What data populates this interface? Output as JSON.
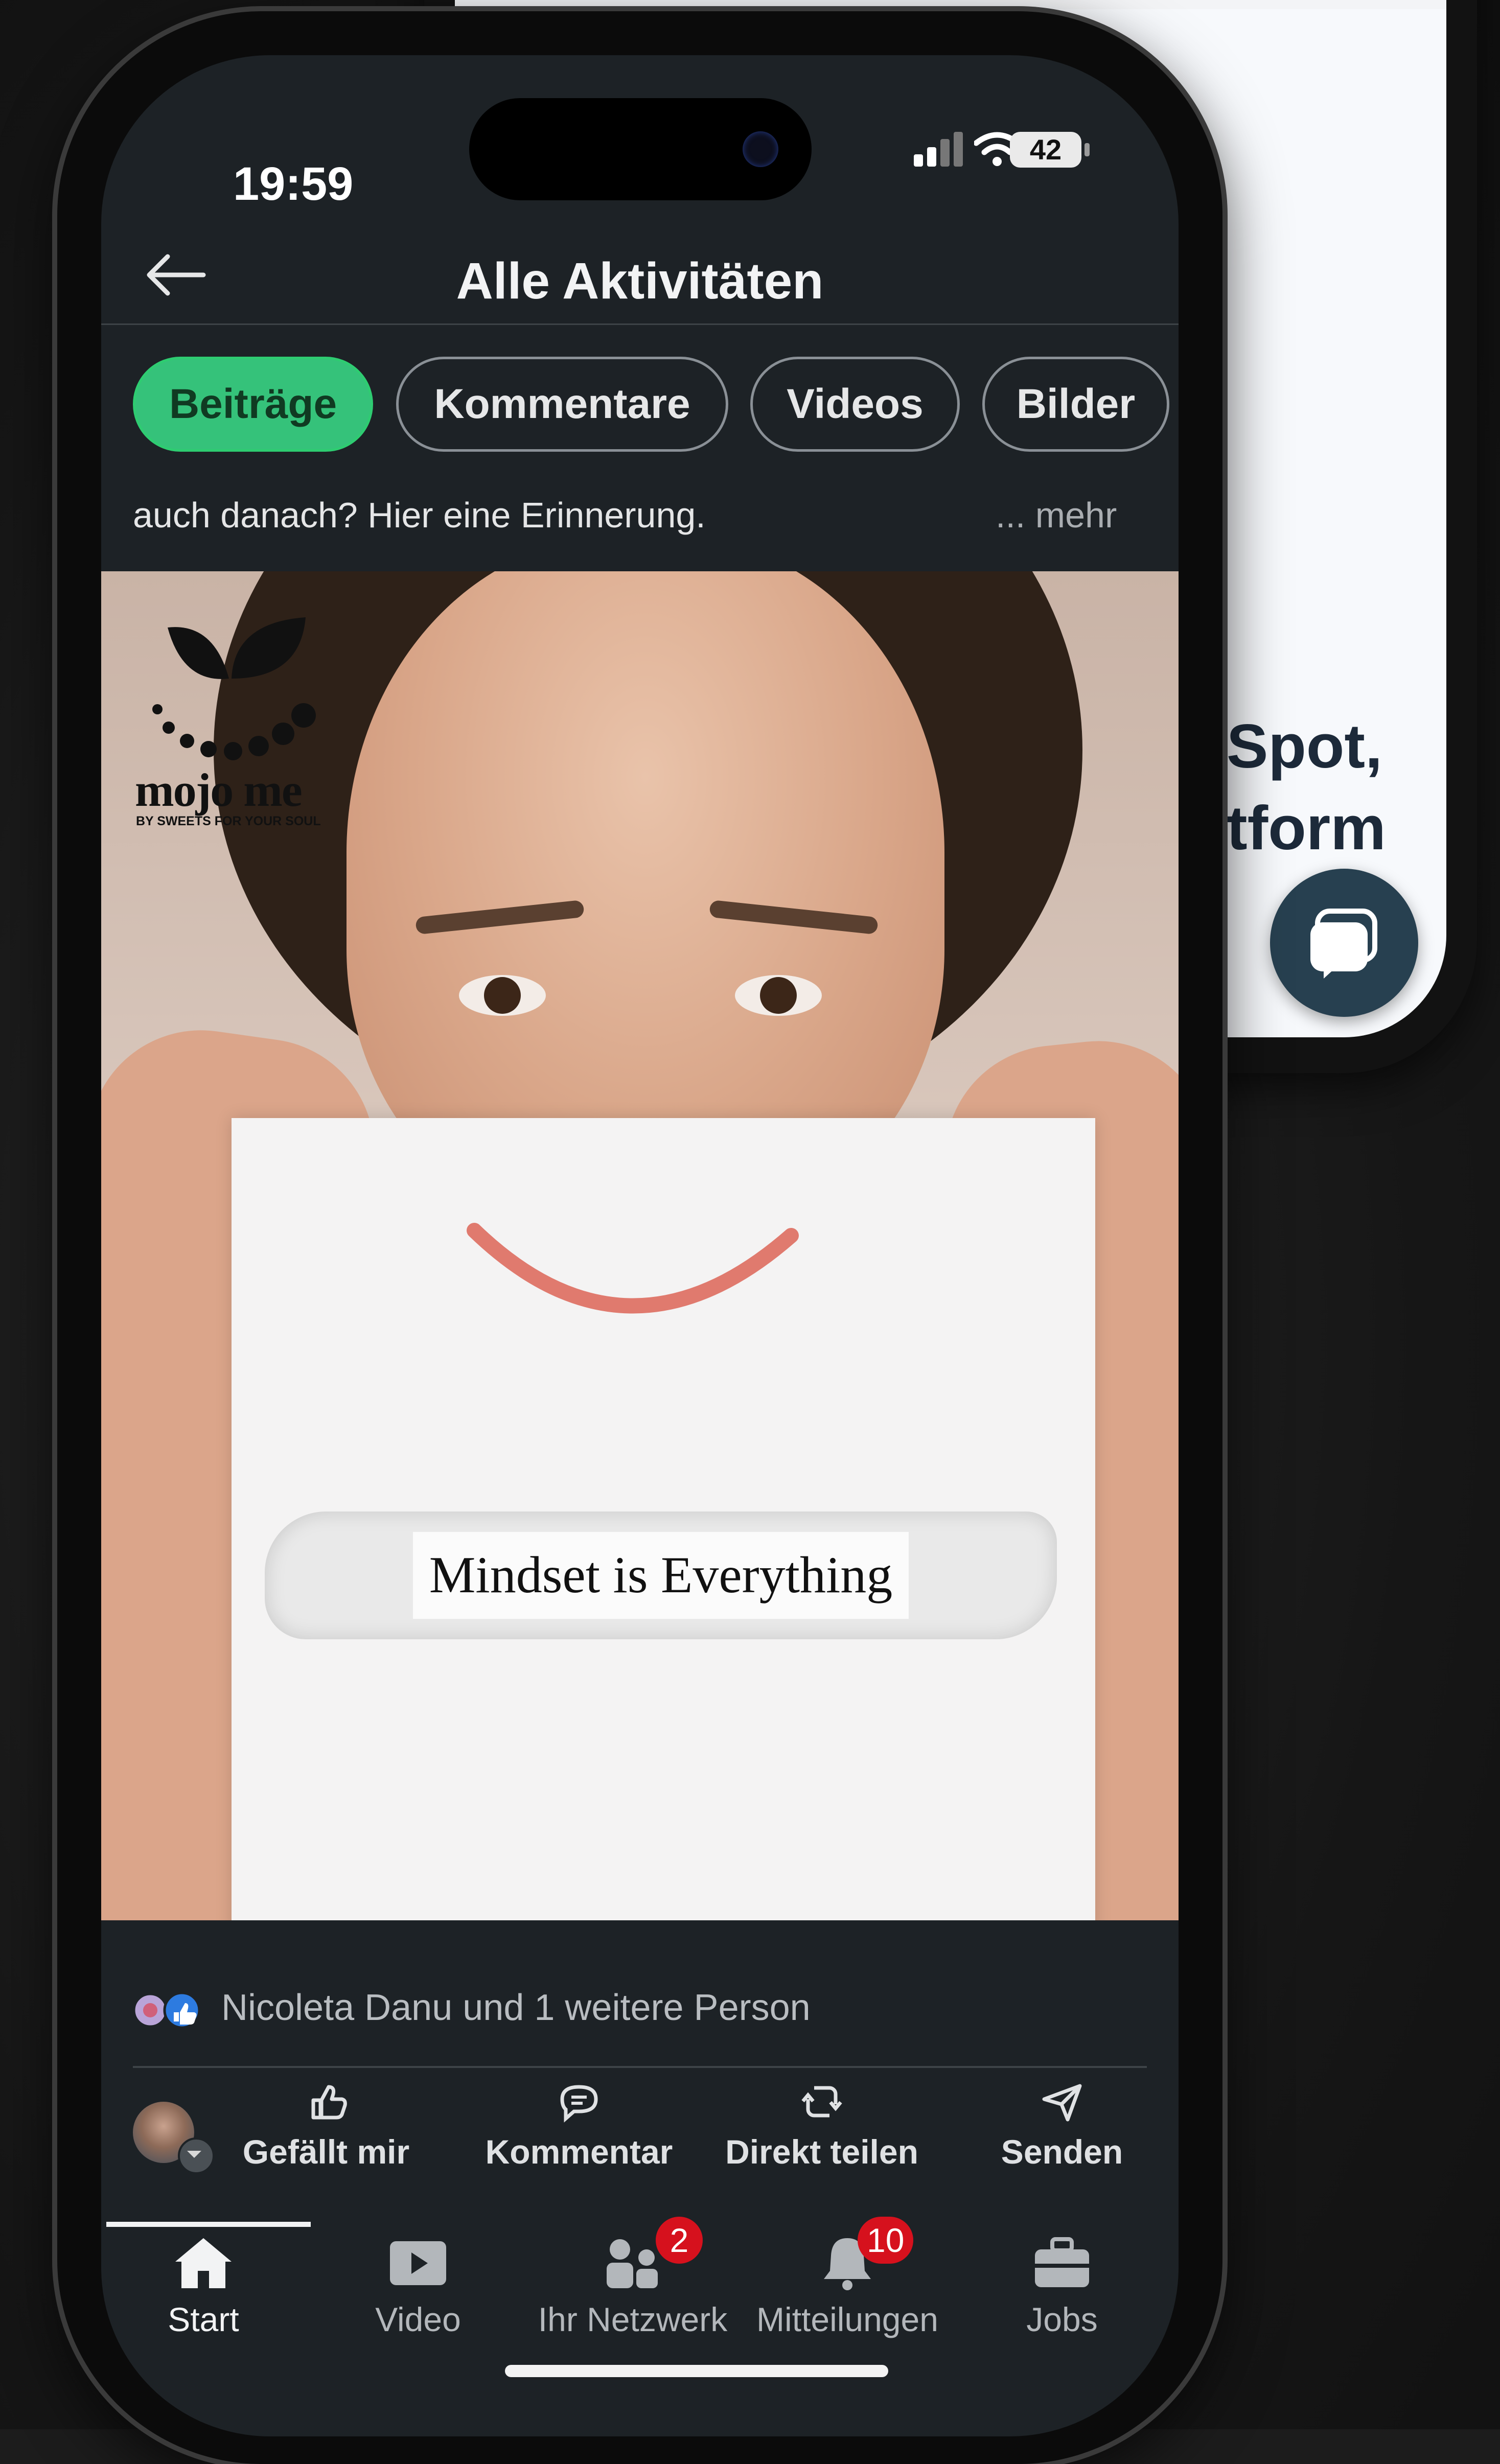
{
  "status_bar": {
    "time": "19:59",
    "battery": "42"
  },
  "header": {
    "title": "Alle Aktivitäten"
  },
  "filters": [
    {
      "label": "Beiträge",
      "active": true
    },
    {
      "label": "Kommentare",
      "active": false
    },
    {
      "label": "Videos",
      "active": false
    },
    {
      "label": "Bilder",
      "active": false
    }
  ],
  "post": {
    "teaser_text": "auch danach? Hier eine Erinnerung.",
    "more_label": "... mehr",
    "image": {
      "logo_word": "mojo me",
      "logo_tagline": "BY SWEETS FOR YOUR SOUL",
      "paper_text": "Mindset is Everything"
    },
    "reactions_text": "Nicoleta Danu und 1 weitere Person"
  },
  "actions": {
    "like": "Gefällt mir",
    "comment": "Kommentar",
    "repost": "Direkt teilen",
    "send": "Senden"
  },
  "tabs": [
    {
      "label": "Start",
      "icon": "home-icon",
      "active": true
    },
    {
      "label": "Video",
      "icon": "video-icon",
      "active": false
    },
    {
      "label": "Ihr Netzwerk",
      "icon": "network-icon",
      "active": false,
      "badge": "2"
    },
    {
      "label": "Mitteilungen",
      "icon": "bell-icon",
      "active": false,
      "badge": "10"
    },
    {
      "label": "Jobs",
      "icon": "briefcase-icon",
      "active": false
    }
  ],
  "background_phone": {
    "text_line_1": "Spot,",
    "text_line_2": "tform"
  },
  "colors": {
    "active_chip": "#35c27a",
    "app_background": "#1d2226",
    "badge": "#d6111d"
  }
}
